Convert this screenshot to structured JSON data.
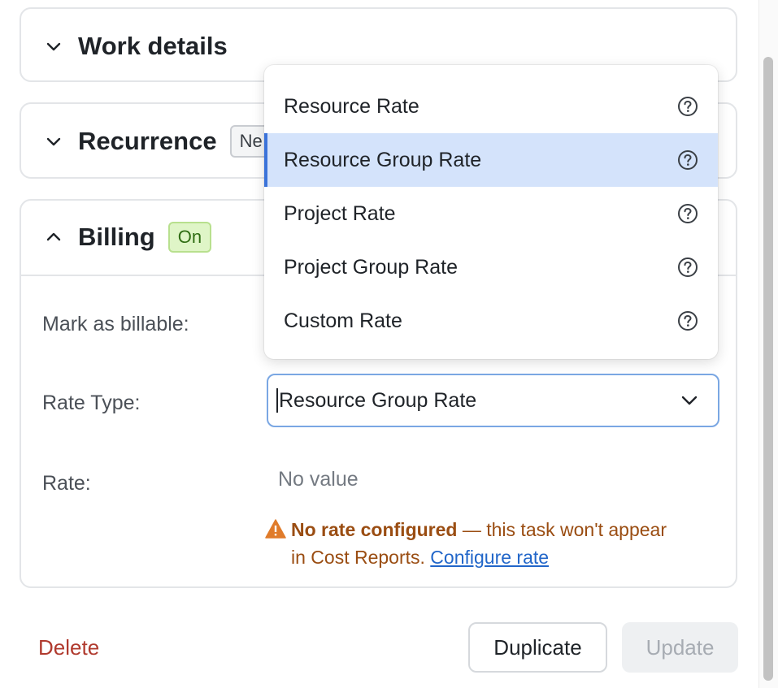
{
  "sections": {
    "work_details": {
      "title": "Work details"
    },
    "recurrence": {
      "title": "Recurrence",
      "badge": "Ne"
    },
    "billing": {
      "title": "Billing",
      "badge": "On"
    }
  },
  "billing_form": {
    "mark_billable_label": "Mark as billable:",
    "rate_type_label": "Rate Type:",
    "rate_type_value": "Resource Group Rate",
    "rate_label": "Rate:",
    "rate_value": "No value",
    "warning": {
      "strong": "No rate configured",
      "text1": " — this task won't appear",
      "text2": "in Cost Reports.",
      "link": "Configure rate"
    }
  },
  "dropdown": {
    "options": [
      {
        "label": "Resource Rate"
      },
      {
        "label": "Resource Group Rate",
        "selected": true
      },
      {
        "label": "Project Rate"
      },
      {
        "label": "Project Group Rate"
      },
      {
        "label": "Custom Rate"
      }
    ]
  },
  "footer": {
    "delete_label": "Delete",
    "duplicate_label": "Duplicate",
    "update_label": "Update"
  },
  "colors": {
    "accent": "#3b73d9",
    "selected_bg": "#d4e3fb",
    "warning": "#9a4d12",
    "delete": "#b03a2e",
    "badge_on_bg": "#dff5c7"
  },
  "icons": {
    "collapse": "chevron-down-icon",
    "expand": "chevron-up-icon",
    "help": "question-circle-icon",
    "warning": "warning-triangle-icon"
  }
}
